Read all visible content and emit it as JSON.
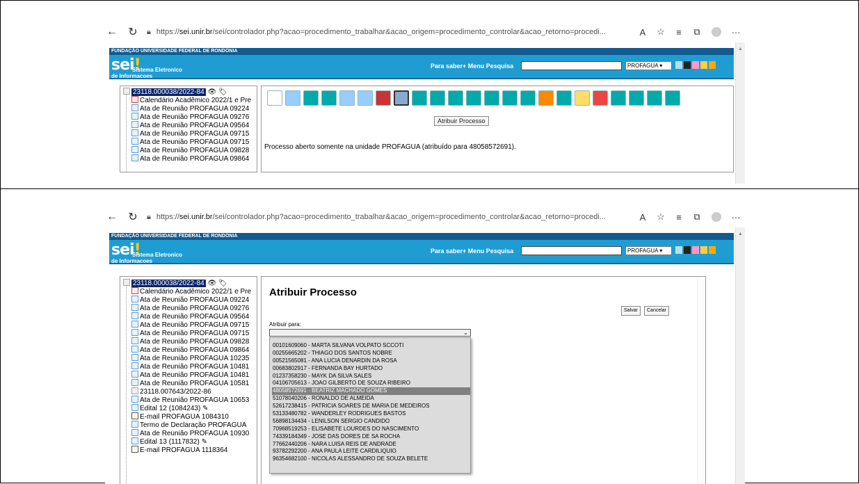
{
  "browser": {
    "url_prefix": "https://",
    "url_domain": "sei.unir.br",
    "url_rest": "/sei/controlador.php?acao=procedimento_trabalhar&acao_origem=procedimento_controlar&acao_retorno=procedi...",
    "more": "···"
  },
  "sei": {
    "org": "FUNDAÇÃO UNIVERSIDADE FEDERAL DE RONDÔNIA",
    "logo": "sei",
    "logo_mark": "!",
    "line1": "Sistema Eletronico",
    "line2": "de Informacoes",
    "links": "Para saber+  Menu  Pesquisa",
    "unit": "PROFAGUA"
  },
  "tree1": {
    "process": "23118.000038/2022-84",
    "items": [
      "Calendário Acadêmico 2022/1 e Pre",
      "Ata de Reunião PROFAGUA 09224",
      "Ata de Reunião PROFAGUA 09276",
      "Ata de Reunião PROFAGUA 09564",
      "Ata de Reunião PROFAGUA 09715",
      "Ata de Reunião PROFAGUA 09715",
      "Ata de Reunião PROFAGUA 09828",
      "Ata de Reunião PROFAGUA 09864"
    ]
  },
  "panel1": {
    "tooltip": "Atribuir Processo",
    "message": "Processo aberto somente na unidade PROFAGUA (atribuído para 48058572691)."
  },
  "tree2": {
    "process": "23118.000038/2022-84",
    "items": [
      "Calendário Acadêmico 2022/1 e Pre",
      "Ata de Reunião PROFAGUA 09224",
      "Ata de Reunião PROFAGUA 09276",
      "Ata de Reunião PROFAGUA 09564",
      "Ata de Reunião PROFAGUA 09715",
      "Ata de Reunião PROFAGUA 09715",
      "Ata de Reunião PROFAGUA 09828",
      "Ata de Reunião PROFAGUA 09864",
      "Ata de Reunião PROFAGUA 10235",
      "Ata de Reunião PROFAGUA 10481",
      "Ata de Reunião PROFAGUA 10481",
      "Ata de Reunião PROFAGUA 10581",
      "23118.007643/2022-86",
      "Ata de Reunião PROFAGUA 10653",
      "Edital 12 (1084243)",
      "E-mail PROFAGUA 1084310",
      "Termo de Declaração PROFAGUA",
      "Ata de Reunião PROFAGUA 10930",
      "Edital 13 (1117832)",
      "E-mail PROFAGUA 1118364"
    ]
  },
  "form": {
    "title": "Atribuir Processo",
    "save": "Salvar",
    "cancel": "Cancelar",
    "label": "Atribuir para:",
    "selected_index": 6,
    "options": [
      "00101609060 - MARTA SILVANA VOLPATO SCCOTI",
      "00255665202 - THIAGO DOS SANTOS NOBRE",
      "00521565081 - ANA LUCIA DENARDIN DA ROSA",
      "00683802917 - FERNANDA BAY HURTADO",
      "01237358230 - MAYK DA SILVA SALES",
      "04106705613 - JOAO GILBERTO DE SOUZA RIBEIRO",
      "48058572691 - BEATRIZ MACHADO GOMES",
      "51078040206 - RONALDO DE ALMEIDA",
      "52617238415 - PATRICIA SOARES DE MARIA DE MEDEIROS",
      "53133480782 - WANDERLEY RODRIGUES BASTOS",
      "56898134434 - LENILSON SERGIO CANDIDO",
      "70968519253 - ELISABETE LOURDES DO NASCIMENTO",
      "74339184349 - JOSE DAS DORES DE SA ROCHA",
      "77662440206 - NARA LUISA REIS DE ANDRADE",
      "93782292200 - ANA PAULA LEITE CARDILIQUIO",
      "96354682100 - NICOLAS ALESSANDRO DE SOUZA BELETE"
    ]
  },
  "colors": {
    "orgbar": "#135a8e",
    "seibar": "#1f9dd3",
    "highlight": "#808080"
  }
}
